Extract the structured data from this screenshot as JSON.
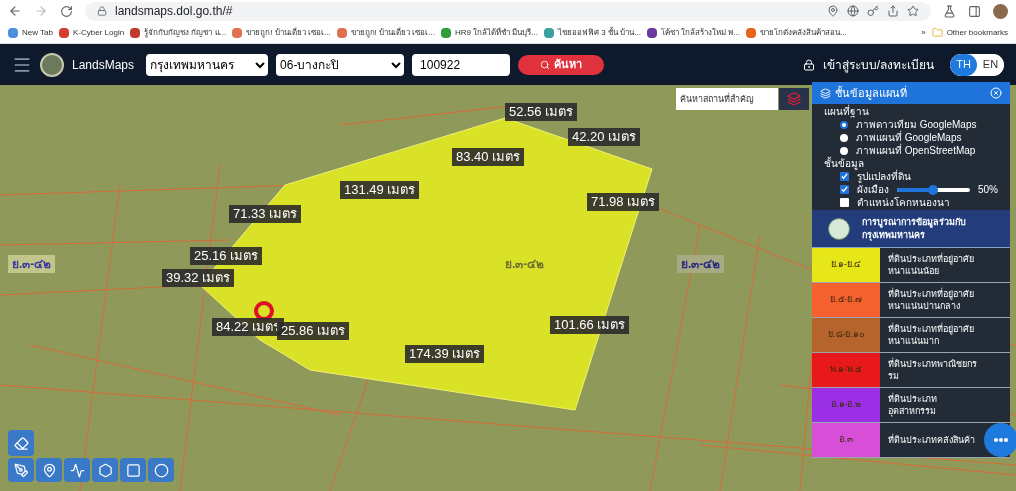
{
  "browser": {
    "url": "landsmaps.dol.go.th/#",
    "bookmarks": [
      "New Tab",
      "K-Cyber Login",
      "รู้จักกับกัญชง กัญชา แ...",
      "ขายถูก! บ้านเดี่ยว เซอเ...",
      "ขายถูก! บ้านเดี่ยว เซอเ...",
      "HR9 ใกล้ได้ที่ชำ มีนบุรี...",
      "ไชยออฟฟิศ 3 ชั้น บ้าน...",
      "โค้ชา ใกล้สร้างใหม่ พ...",
      "ขายโกดังคลังสินค้าสอน..."
    ],
    "more": "»",
    "other_bookmarks": "Other bookmarks"
  },
  "header": {
    "brand": "LandsMaps",
    "province": "กรุงเทพมหานคร",
    "district": "06-บางกะปิ",
    "parcel_number": "100922",
    "search_button": "ค้นหา",
    "login": "เข้าสู่ระบบ/ลงทะเบียน",
    "languages": [
      {
        "label": "TH",
        "selected": true
      },
      {
        "label": "EN",
        "selected": false
      }
    ]
  },
  "map": {
    "landmark_search": {
      "placeholder": "ค้นหาสถานที่สำคัญ"
    },
    "measurements": [
      "52.56 เมตร",
      "42.20 เมตร",
      "83.40 เมตร",
      "131.49 เมตร",
      "71.33 เมตร",
      "71.98 เมตร",
      "25.16 เมตร",
      "39.32 เมตร",
      "84.22 เมตร",
      "25.86 เมตร",
      "174.39 เมตร",
      "101.66 เมตร"
    ],
    "zone_labels": [
      {
        "text": "ย.๓-๔๒",
        "kind": "light"
      },
      {
        "text": "ย.๓-๔๒",
        "kind": "plain"
      },
      {
        "text": "ย.๓-๔๒",
        "kind": "dark"
      }
    ]
  },
  "layers_panel": {
    "title": "ชั้นข้อมูลแผนที่",
    "base_title": "แผนที่ฐาน",
    "base_maps": [
      {
        "label": "ภาพดาวเทียม GoogleMaps",
        "selected": true
      },
      {
        "label": "ภาพแผนที่ GoogleMaps",
        "selected": false
      },
      {
        "label": "ภาพแผนที่ OpenStreetMap",
        "selected": false
      }
    ],
    "layers_title": "ชั้นข้อมูล",
    "layers": [
      {
        "kind": "checkbox",
        "label": "รูปแปลงที่ดิน",
        "checked": true
      },
      {
        "kind": "slider",
        "label": "ผังเมือง",
        "checked": true,
        "level": 0.5,
        "reading": "50%"
      },
      {
        "kind": "checkbox",
        "label": "ตำแหน่งโคกหนองนา",
        "checked": false
      }
    ],
    "banner": "การบูรณาการข้อมูลร่วมกับ กรุงเทพมหานคร",
    "legend": [
      {
        "code": "ย.๑-ย.๔",
        "color": "#e6e619",
        "description": "ที่ดินประเภทที่อยู่อาศัยหนาแน่นน้อย"
      },
      {
        "code": "ย.๕-ย.๗",
        "color": "#f4612f",
        "description": "ที่ดินประเภทที่อยู่อาศัยหนาแน่นปานกลาง"
      },
      {
        "code": "ย.๘-ย.๑๐",
        "color": "#b5652c",
        "description": "ที่ดินประเภทที่อยู่อาศัยหนาแน่นมาก"
      },
      {
        "code": "พ.๑-พ.๕",
        "color": "#e8191a",
        "description": "ที่ดินประเภทพาณิชยกรรม"
      },
      {
        "code": "อ.๑-อ.๒",
        "color": "#9b2fe6",
        "description": "ที่ดินประเภทอุตสาหกรรม"
      },
      {
        "code": "อ.๓",
        "color": "#d64fd6",
        "description": "ที่ดินประเภทคลังสินค้า"
      }
    ]
  }
}
